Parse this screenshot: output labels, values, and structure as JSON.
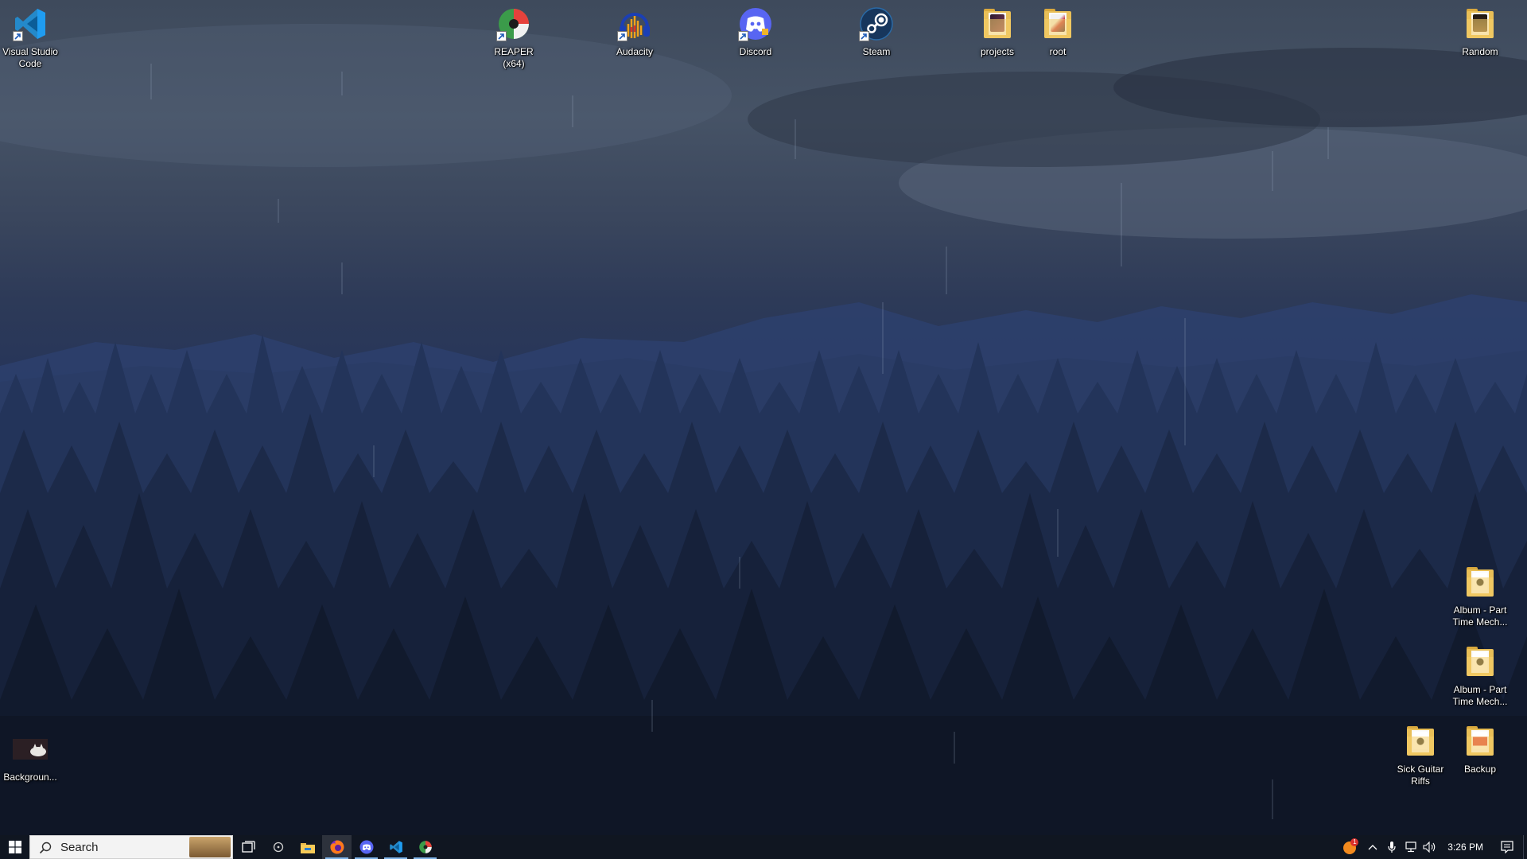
{
  "desktop": {
    "icons": [
      {
        "label": "Visual Studio Code",
        "icon": "vscode-icon"
      },
      {
        "label": "REAPER (x64)",
        "icon": "reaper-icon"
      },
      {
        "label": "Audacity",
        "icon": "audacity-icon"
      },
      {
        "label": "Discord",
        "icon": "discord-icon"
      },
      {
        "label": "Steam",
        "icon": "steam-icon"
      },
      {
        "label": "projects",
        "icon": "folder-icon"
      },
      {
        "label": "root",
        "icon": "folder-icon"
      },
      {
        "label": "Random",
        "icon": "folder-icon"
      },
      {
        "label": "Album - Part Time Mech...",
        "icon": "folder-icon"
      },
      {
        "label": "Album - Part Time Mech...",
        "icon": "folder-icon"
      },
      {
        "label": "Sick Guitar Riffs",
        "icon": "folder-icon"
      },
      {
        "label": "Backup",
        "icon": "folder-icon"
      },
      {
        "label": "Backgroun...",
        "icon": "image-file-icon"
      }
    ]
  },
  "taskbar": {
    "search_placeholder": "Search",
    "clock": "3:26 PM",
    "pinned": [
      "task-view-icon",
      "cortana-icon",
      "file-explorer-icon",
      "firefox-icon",
      "discord-icon",
      "vscode-icon",
      "reaper-icon"
    ],
    "notification_count": "1",
    "accent": "#7fb3e8"
  }
}
